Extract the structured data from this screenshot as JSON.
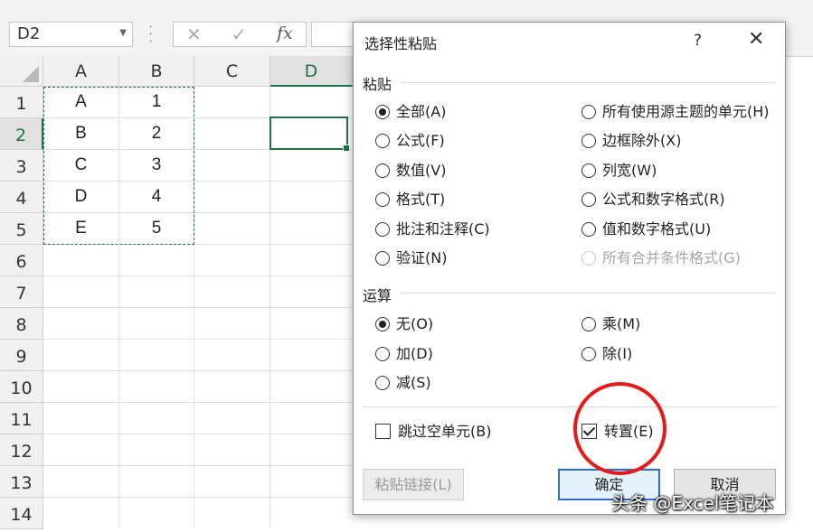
{
  "formula_bar": {
    "name_box": "D2",
    "cancel_icon": "✕",
    "enter_icon": "✓",
    "fx_label": "fx"
  },
  "sheet": {
    "columns": [
      "A",
      "B",
      "C",
      "D"
    ],
    "rows": [
      "1",
      "2",
      "3",
      "4",
      "5",
      "6",
      "7",
      "8",
      "9",
      "10",
      "11",
      "12",
      "13",
      "14"
    ],
    "selected_column": "D",
    "selected_row": "2",
    "cells": {
      "A": [
        "A",
        "B",
        "C",
        "D",
        "E"
      ],
      "B": [
        "1",
        "2",
        "3",
        "4",
        "5"
      ]
    }
  },
  "dialog": {
    "title": "选择性粘贴",
    "help_icon": "?",
    "close_icon": "✕",
    "paste_section": "粘贴",
    "paste_options": {
      "all": "全部(A)",
      "formulas": "公式(F)",
      "values": "数值(V)",
      "formats": "格式(T)",
      "comments": "批注和注释(C)",
      "validation": "验证(N)",
      "source_theme": "所有使用源主题的单元(H)",
      "except_borders": "边框除外(X)",
      "column_widths": "列宽(W)",
      "formulas_numbers": "公式和数字格式(R)",
      "values_numbers": "值和数字格式(U)",
      "merge_conditional": "所有合并条件格式(G)"
    },
    "operation_section": "运算",
    "operation_options": {
      "none": "无(O)",
      "add": "加(D)",
      "subtract": "减(S)",
      "multiply": "乘(M)",
      "divide": "除(I)"
    },
    "skip_blanks": "跳过空单元(B)",
    "transpose": "转置(E)",
    "paste_link": "粘贴链接(L)",
    "ok": "确定",
    "cancel": "取消",
    "selected_paste": "all",
    "selected_operation": "none",
    "transpose_checked": true,
    "skip_blanks_checked": false
  },
  "watermark": "头条 @Excel笔记本",
  "colors": {
    "excel_green": "#217346",
    "annotation_red": "#e31b1b",
    "focus_blue": "#2c6bd0"
  }
}
